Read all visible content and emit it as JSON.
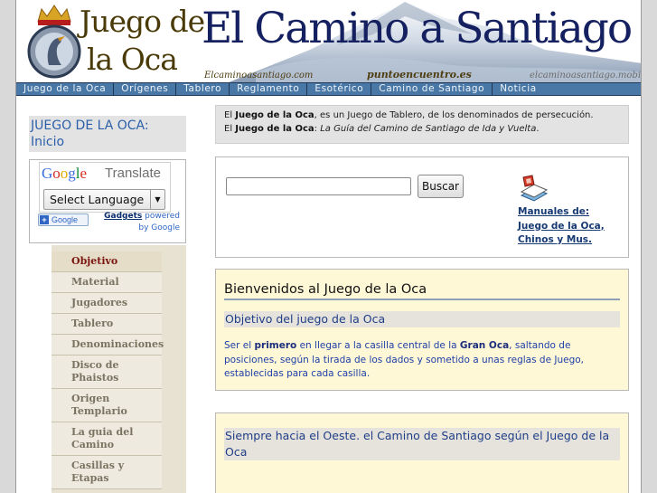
{
  "banner": {
    "brand_line1": "Juego de",
    "brand_line2": "la Oca",
    "site_title": "El Camino a Santiago",
    "small_left": "Elcaminoasantiago.com",
    "small_center": "puntoencuentro.es",
    "small_right": "elcaminoasantiago.mobi"
  },
  "nav": {
    "items": [
      "Juego de la Oca",
      "Orígenes",
      "Tablero",
      "Reglamento",
      "Esotérico",
      "Camino de Santiago",
      "Noticia"
    ]
  },
  "sidebar": {
    "section_title": "JUEGO DE LA OCA: Inicio",
    "translate": {
      "google_letters": [
        "G",
        "o",
        "o",
        "g",
        "l",
        "e"
      ],
      "translate_word": "Translate",
      "select_label": "Select Language",
      "add_label": "Google",
      "gadgets_link": "Gadgets",
      "powered_by": "powered by Google"
    },
    "menu": [
      "Objetivo",
      "Material",
      "Jugadores",
      "Tablero",
      "Denominaciones",
      "Disco de Phaistos",
      "Origen Templario",
      "La guia del Camino",
      "Casillas y Etapas"
    ],
    "active_index": 0
  },
  "intro": {
    "l1_pre": "El ",
    "l1_bold": "Juego de la Oca",
    "l1_post": ", es un Juego de Tablero, de los denominados de persecución.",
    "l2_pre": "El ",
    "l2_bold": "Juego de la Oca",
    "l2_colon": ": ",
    "l2_italic": "La Guía del Camino de Santiago de Ida y Vuelta",
    "l2_end": "."
  },
  "search": {
    "value": "",
    "button_label": "Buscar",
    "manuals_line1": "Manuales de:",
    "manuals_line2": "Juego de la Oca,",
    "manuals_line3": "Chinos y Mus."
  },
  "welcome": {
    "title": "Bienvenidos al Juego de la Oca",
    "subtitle": "Objetivo del juego de la Oca",
    "t1": "Ser el ",
    "t2": "primero",
    "t3": " en llegar a la casilla central de la ",
    "t4": "Gran Oca",
    "t5": ", saltando de posiciones, según la tirada de los dados y sometido a unas reglas de Juego, establecidas para cada casilla."
  },
  "west": {
    "title": "Siempre hacia el Oeste. el Camino de Santiago según el Juego de la Oca"
  },
  "colors": {
    "nav_bg": "#4a78a6",
    "title_blue": "#14205f",
    "link_blue": "#173a73",
    "content_bg": "#fff8d6",
    "sidebar_bg": "#e8e2d2"
  }
}
